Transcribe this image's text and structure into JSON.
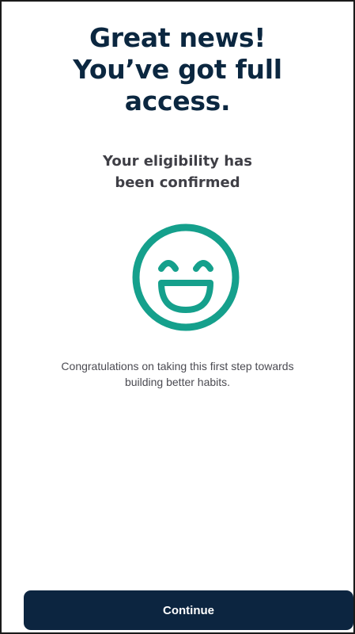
{
  "headline": {
    "line1": "Great news!",
    "line2": "You’ve got full",
    "line3": "access."
  },
  "subheadline": {
    "line1": "Your eligibility has",
    "line2": "been confirmed"
  },
  "illustration": {
    "icon": "smiley-face-icon",
    "color": "#15a08c"
  },
  "message": {
    "line1": "Congratulations on taking this first step towards",
    "line2": "building better habits."
  },
  "continue_button": {
    "label": "Continue",
    "background": "#0c2540"
  },
  "colors": {
    "heading": "#0b2740",
    "subheading": "#3f3f46",
    "body": "#4b4b52"
  }
}
